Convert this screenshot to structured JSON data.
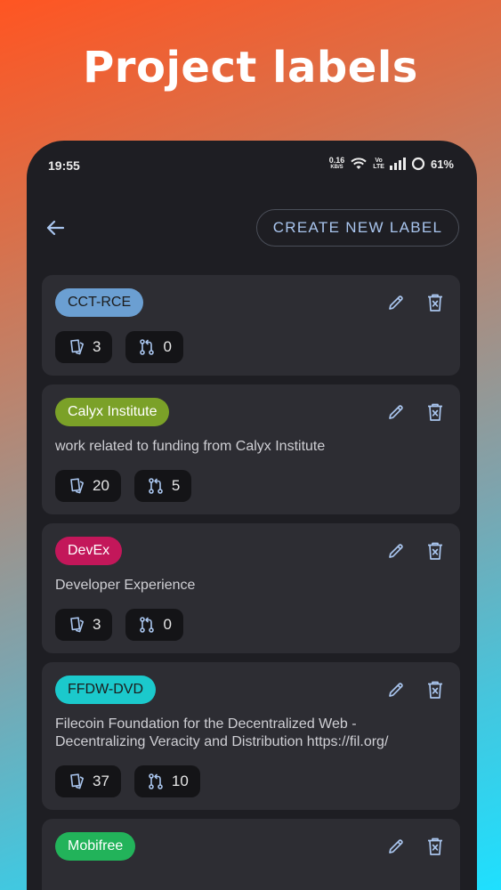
{
  "headline": "Project labels",
  "status_bar": {
    "time": "19:55",
    "net_speed_value": "0.16",
    "net_speed_unit": "KB/S",
    "volte_top": "Vo",
    "volte_bottom": "LTE",
    "battery": "61%"
  },
  "toolbar": {
    "create_label": "CREATE NEW LABEL"
  },
  "colors": {
    "accent": "#a9c5ee",
    "card_bg": "#2d2d33",
    "screen_bg": "#1e1e23"
  },
  "labels": [
    {
      "name": "CCT-RCE",
      "color": "#6b9fd2",
      "text_style": "light",
      "description": "",
      "tickets": "3",
      "pull_requests": "0"
    },
    {
      "name": "Calyx Institute",
      "color": "#7ba128",
      "text_style": "dark",
      "description": "work related to funding from Calyx Institute",
      "tickets": "20",
      "pull_requests": "5"
    },
    {
      "name": "DevEx",
      "color": "#c3175a",
      "text_style": "dark",
      "description": "Developer Experience",
      "tickets": "3",
      "pull_requests": "0"
    },
    {
      "name": "FFDW-DVD",
      "color": "#1bc9cc",
      "text_style": "light",
      "description": "Filecoin Foundation for the Decentralized Web - Decentralizing Veracity and Distribution https://fil.org/",
      "tickets": "37",
      "pull_requests": "10"
    },
    {
      "name": "Mobifree",
      "color": "#22b35a",
      "text_style": "dark",
      "description": "",
      "tickets": "",
      "pull_requests": ""
    }
  ]
}
